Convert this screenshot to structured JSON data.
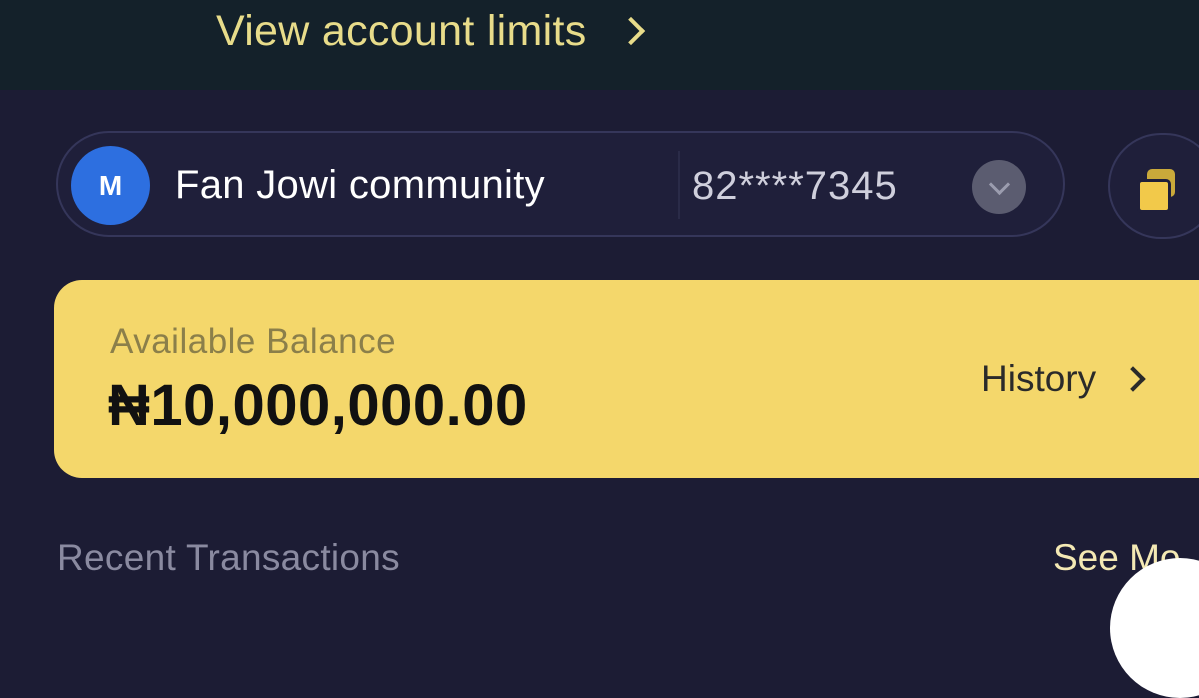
{
  "banner": {
    "limits_label": "View account limits"
  },
  "account": {
    "avatar_initial": "M",
    "name": "Fan Jowi community",
    "number_masked": "82****7345"
  },
  "balance": {
    "label": "Available Balance",
    "amount": "₦10,000,000.00",
    "history_label": "History"
  },
  "transactions": {
    "title": "Recent Transactions",
    "see_more_label": "See Mo"
  },
  "icons": [
    "chevron-right-icon",
    "chevron-down-icon",
    "copy-icon"
  ],
  "colors": {
    "accent": "#f4d76b",
    "background": "#1c1c34",
    "avatar": "#2d6fe0"
  }
}
